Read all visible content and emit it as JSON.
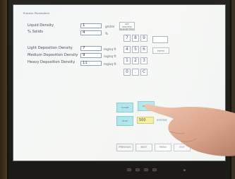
{
  "screen": {
    "title": "Process Parameters",
    "fields": [
      {
        "label": "Liquid Density",
        "value": "1",
        "unit": "gm/ml"
      },
      {
        "label": "% Solids",
        "value": "4",
        "unit": "%"
      },
      {
        "label": "Light Deposition Density",
        "value": "7",
        "unit": "mg/sq ft"
      },
      {
        "label": "Medium Deposition Density",
        "value": "9",
        "unit": "mg/sq ft"
      },
      {
        "label": "Heavy Deposition Density",
        "value": "11",
        "unit": "mg/sq ft"
      }
    ],
    "top_button": "SET PROCESS PARAMETERS",
    "keypad": {
      "keys": [
        "7",
        "8",
        "9",
        "4",
        "5",
        "6",
        "1",
        "2",
        "3",
        "0",
        ".",
        "C"
      ],
      "enter_label": "ENTER",
      "display_value": ""
    },
    "cyan_buttons": [
      "ALARM",
      "RESET",
      "STOP"
    ],
    "yellow_field": {
      "value": "500",
      "label": "SYSTEM"
    },
    "bottom_buttons": [
      "PREVIOUS",
      "NEXT",
      "MENU",
      "EXIT"
    ]
  },
  "colors": {
    "screen_bg": "#f4f7f6",
    "cyan": "#a9e4ea",
    "yellow": "#f5ef8e"
  }
}
